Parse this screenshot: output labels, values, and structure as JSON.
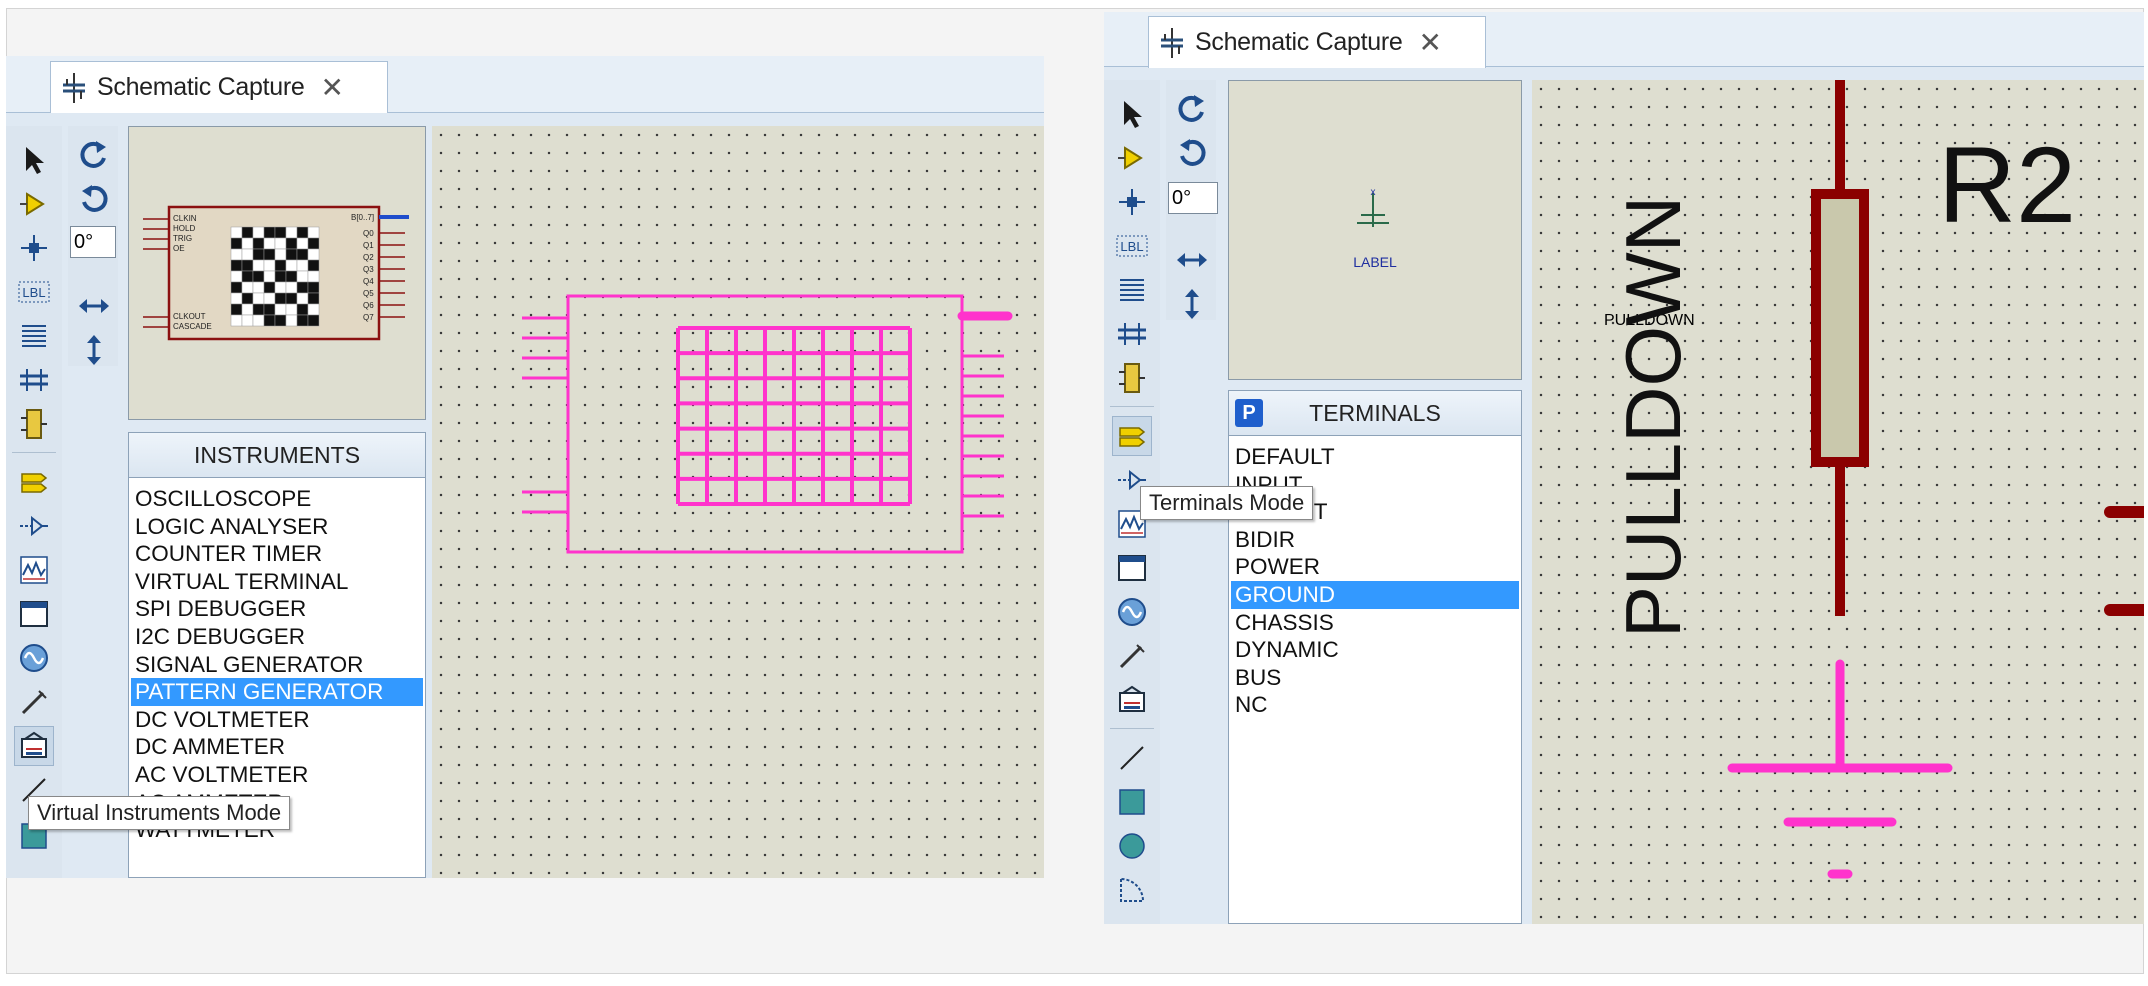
{
  "left_window": {
    "tab_title": "Schematic Capture",
    "tab_close": "✕",
    "angle_value": "0°",
    "list_header": "INSTRUMENTS",
    "list_items": [
      "OSCILLOSCOPE",
      "LOGIC ANALYSER",
      "COUNTER TIMER",
      "VIRTUAL TERMINAL",
      "SPI DEBUGGER",
      "I2C DEBUGGER",
      "SIGNAL GENERATOR",
      "PATTERN GENERATOR",
      "DC VOLTMETER",
      "DC AMMETER",
      "AC VOLTMETER",
      "AC AMMETER",
      "WATTMETER"
    ],
    "selected_item": "PATTERN GENERATOR",
    "tooltip": "Virtual Instruments Mode",
    "chip_left_pins": [
      "CLKIN",
      "HOLD",
      "TRIG",
      "OE"
    ],
    "chip_left_pins_bottom": [
      "CLKOUT",
      "CASCADE"
    ],
    "chip_right_bus": "B[0..7]",
    "chip_right_pins": [
      "Q0",
      "Q1",
      "Q2",
      "Q3",
      "Q4",
      "Q5",
      "Q6",
      "Q7"
    ]
  },
  "right_window": {
    "tab_title": "Schematic Capture",
    "tab_close": "✕",
    "angle_value": "0°",
    "preview_label": "LABEL",
    "list_header": "TERMINALS",
    "list_badge": "P",
    "list_items": [
      "DEFAULT",
      "INPUT",
      "OUTPUT",
      "BIDIR",
      "POWER",
      "GROUND",
      "CHASSIS",
      "DYNAMIC",
      "BUS",
      "NC"
    ],
    "selected_item": "GROUND",
    "tooltip": "Terminals Mode",
    "canvas_label_vertical": "PULLDOWN",
    "canvas_label_ref": "R2"
  },
  "colors": {
    "accent_pink": "#ff33cc",
    "wire_dark_red": "#8b0000",
    "selection_blue": "#3399ff",
    "canvas_bg": "#deded0"
  }
}
